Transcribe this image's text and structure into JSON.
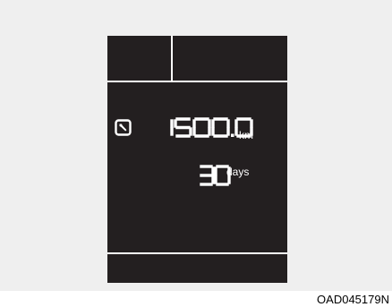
{
  "service_reminder": {
    "distance_value": "1500.0",
    "distance_unit": "km",
    "days_value": "30",
    "days_unit": "days",
    "icon": "wrench-icon"
  },
  "figure": {
    "code": "OAD045179N"
  },
  "colors": {
    "display_background": "#231f20",
    "display_foreground": "#ffffff",
    "panel_background": "#efefef"
  }
}
